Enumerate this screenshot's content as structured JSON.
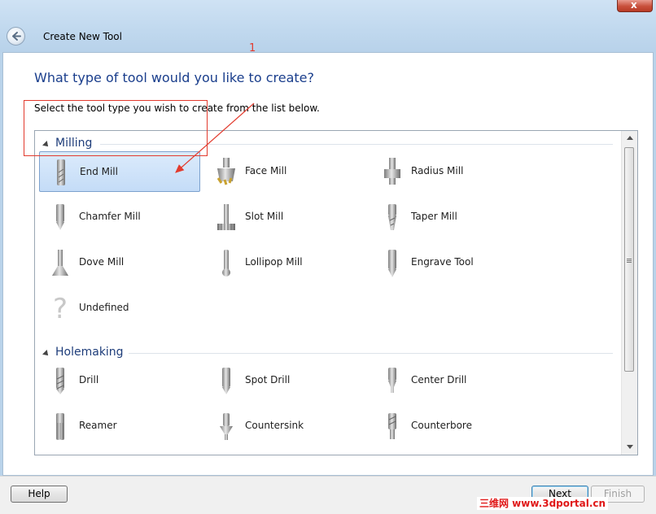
{
  "window": {
    "title": "Create New Tool",
    "close_glyph": "x"
  },
  "page": {
    "heading": "What type of tool would you like to create?",
    "instruction": "Select the tool type you wish to create from the list below."
  },
  "annotation": {
    "number": "1",
    "color": "#e23b2e"
  },
  "groups": [
    {
      "label": "Milling",
      "items": [
        {
          "label": "End Mill",
          "icon": "end-mill-icon",
          "selected": true
        },
        {
          "label": "Face Mill",
          "icon": "face-mill-icon"
        },
        {
          "label": "Radius Mill",
          "icon": "radius-mill-icon"
        },
        {
          "label": "Chamfer Mill",
          "icon": "chamfer-mill-icon"
        },
        {
          "label": "Slot Mill",
          "icon": "slot-mill-icon"
        },
        {
          "label": "Taper Mill",
          "icon": "taper-mill-icon"
        },
        {
          "label": "Dove Mill",
          "icon": "dove-mill-icon"
        },
        {
          "label": "Lollipop Mill",
          "icon": "lollipop-mill-icon"
        },
        {
          "label": "Engrave Tool",
          "icon": "engrave-tool-icon"
        },
        {
          "label": "Undefined",
          "icon": "question-mark-icon"
        }
      ]
    },
    {
      "label": "Holemaking",
      "items": [
        {
          "label": "Drill",
          "icon": "drill-icon"
        },
        {
          "label": "Spot Drill",
          "icon": "spot-drill-icon"
        },
        {
          "label": "Center Drill",
          "icon": "center-drill-icon"
        },
        {
          "label": "Reamer",
          "icon": "reamer-icon"
        },
        {
          "label": "Countersink",
          "icon": "countersink-icon"
        },
        {
          "label": "Counterbore",
          "icon": "counterbore-icon"
        }
      ]
    }
  ],
  "buttons": {
    "help": "Help",
    "next": "Next",
    "finish": "Finish"
  },
  "watermark": "三维网 www.3dportal.cn",
  "colors": {
    "heading": "#1a3e8c",
    "selection": "#c4dcf7",
    "annotation": "#e23b2e"
  }
}
